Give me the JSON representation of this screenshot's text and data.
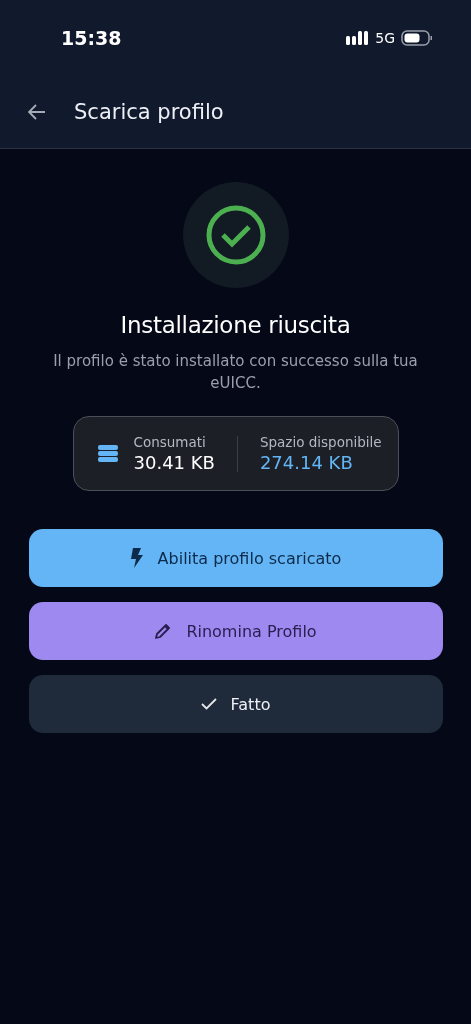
{
  "status_bar": {
    "time": "15:38",
    "network": "5G"
  },
  "app_bar": {
    "title": "Scarica profilo"
  },
  "result": {
    "title": "Installazione riuscita",
    "message": "Il profilo è stato installato con successo sulla tua eUICC."
  },
  "storage": {
    "used_label": "Consumati",
    "used_value": "30.41 KB",
    "free_label": "Spazio disponibile",
    "free_value": "274.14 KB"
  },
  "buttons": [
    {
      "kind": "enable",
      "label": "Abilita profilo scaricato"
    },
    {
      "kind": "rename",
      "label": "Rinomina Profilo"
    },
    {
      "kind": "done",
      "label": "Fatto"
    }
  ]
}
